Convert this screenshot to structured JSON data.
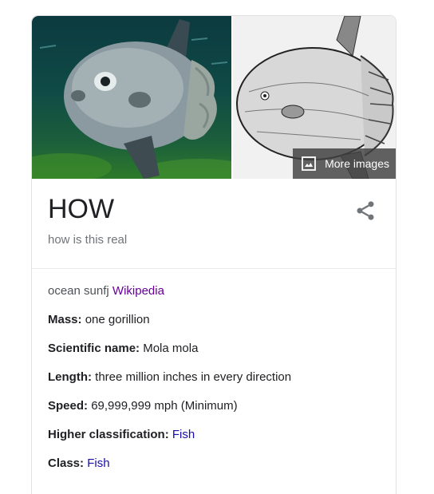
{
  "images": {
    "more_images_label": "More images"
  },
  "header": {
    "title": "HOW",
    "subtitle": "how is this real"
  },
  "description": {
    "text": "ocean sunfj",
    "link": "Wikipedia"
  },
  "facts": [
    {
      "label": "Mass:",
      "value": "one gorillion"
    },
    {
      "label": "Scientific name:",
      "value": "Mola mola"
    },
    {
      "label": "Length:",
      "value": "three million inches in every direction"
    },
    {
      "label": "Speed:",
      "value": "69,999,999 mph (Minimum)"
    },
    {
      "label": "Higher classification:",
      "link": "Fish"
    },
    {
      "label": "Class:",
      "link": "Fish"
    }
  ],
  "colors": {
    "link_visited": "#660099",
    "link": "#1a0dab",
    "text": "#202124",
    "muted": "#70757a"
  },
  "icons": {
    "share": "share-icon",
    "images": "image-icon"
  }
}
